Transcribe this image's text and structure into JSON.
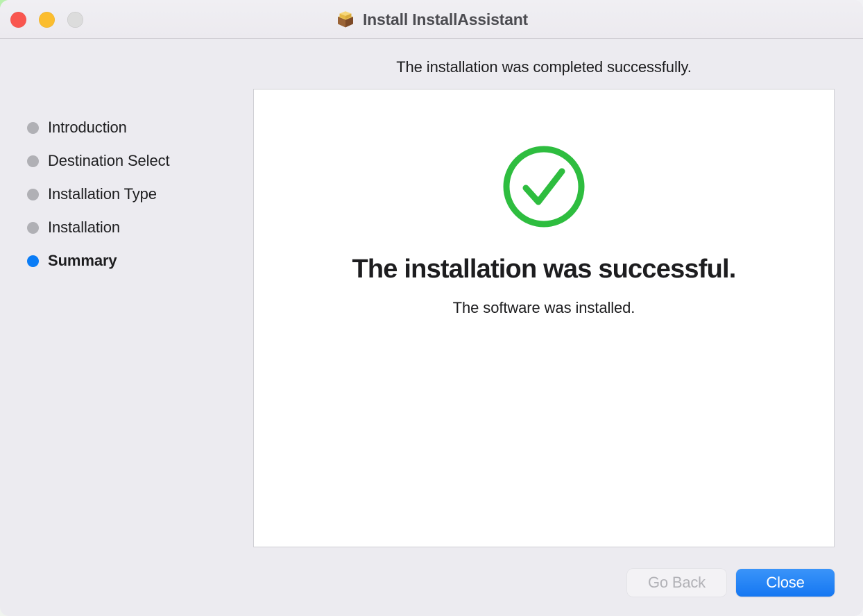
{
  "window": {
    "title": "Install InstallAssistant",
    "icon": "package-box-icon",
    "traffic_lights": [
      {
        "name": "close",
        "color": "#f9564f",
        "label": "Close window"
      },
      {
        "name": "minimize",
        "color": "#fbbd2e",
        "label": "Minimize window"
      },
      {
        "name": "zoom",
        "color": "#dcdcdc",
        "label": "Zoom window"
      }
    ]
  },
  "header": {
    "text": "The installation was completed successfully."
  },
  "sidebar": {
    "steps": [
      {
        "label": "Introduction",
        "state": "done"
      },
      {
        "label": "Destination Select",
        "state": "done"
      },
      {
        "label": "Installation Type",
        "state": "done"
      },
      {
        "label": "Installation",
        "state": "done"
      },
      {
        "label": "Summary",
        "state": "active"
      }
    ]
  },
  "content": {
    "icon": "green-check-circle-icon",
    "title": "The installation was successful.",
    "subtitle": "The software was installed."
  },
  "footer": {
    "go_back_label": "Go Back",
    "close_label": "Close"
  },
  "colors": {
    "accent_blue": "#0a7cf6",
    "success_green": "#2ebd3f",
    "step_dot_gray": "#b0b0b5",
    "window_bg": "#ecebf0",
    "panel_bg": "#ffffff",
    "title_text": "#4c4c51"
  }
}
